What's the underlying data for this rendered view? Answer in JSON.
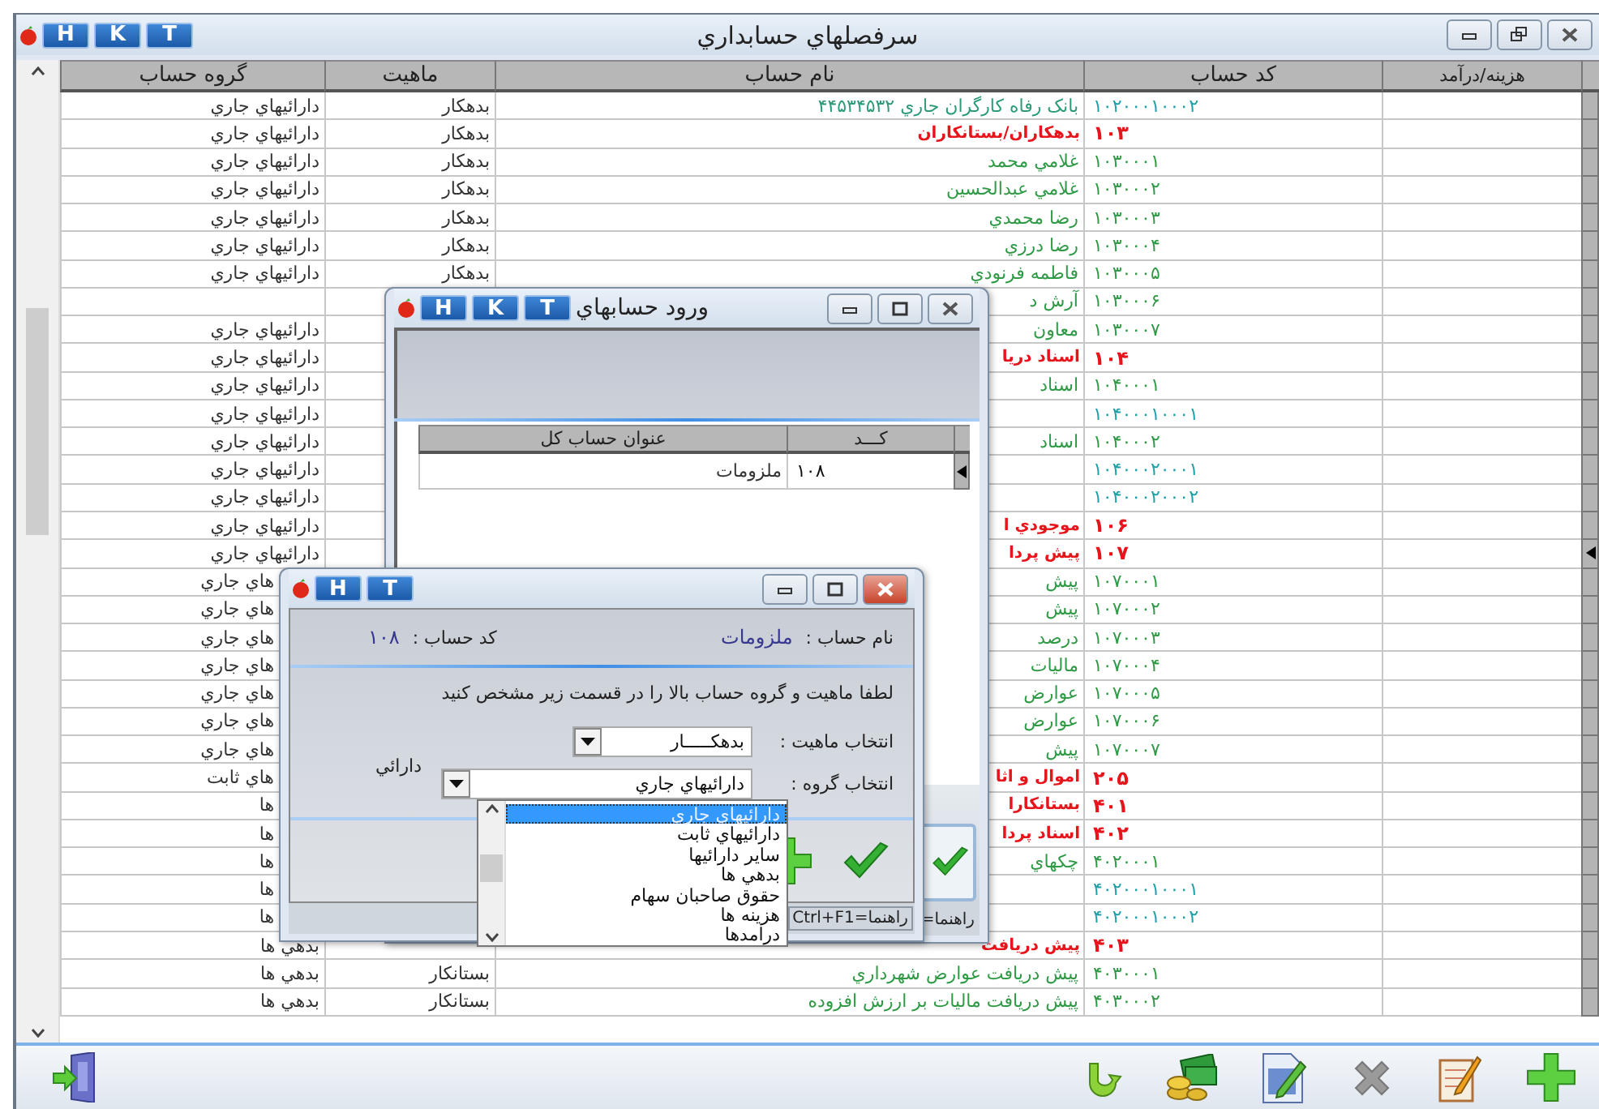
{
  "window": {
    "title": "سرفصلهاي حسابداري",
    "title_buttons": [
      "T",
      "K",
      "H"
    ]
  },
  "table": {
    "columns": [
      "هزينه/درآمد",
      "کد حساب",
      "نام حساب",
      "ماهيت",
      "گروه حساب"
    ],
    "rows": [
      {
        "kind": "sub",
        "code": "۱۰۲۰۰۰۱۰۰۰۲",
        "name": "بانک رفاه کارگران جاري ۴۴۵۳۴۵۳۲",
        "nature": "بدهکار",
        "group": "دارائيهاي جاري",
        "group_cut": false,
        "current": false
      },
      {
        "kind": "group",
        "code": "۱۰۳",
        "name": "بدهکاران/بستانکاران",
        "nature": "بدهکار",
        "group": "دارائيهاي جاري",
        "group_cut": false,
        "current": false
      },
      {
        "kind": "account",
        "code": "۱۰۳۰۰۰۱",
        "name": "غلامي محمد",
        "nature": "بدهکار",
        "group": "دارائيهاي جاري",
        "group_cut": false,
        "current": false
      },
      {
        "kind": "account",
        "code": "۱۰۳۰۰۰۲",
        "name": "غلامي عبدالحسين",
        "nature": "بدهکار",
        "group": "دارائيهاي جاري",
        "group_cut": false,
        "current": false
      },
      {
        "kind": "account",
        "code": "۱۰۳۰۰۰۳",
        "name": "رضا محمدي",
        "nature": "بدهکار",
        "group": "دارائيهاي جاري",
        "group_cut": false,
        "current": false
      },
      {
        "kind": "account",
        "code": "۱۰۳۰۰۰۴",
        "name": "رضا درزي",
        "nature": "بدهکار",
        "group": "دارائيهاي جاري",
        "group_cut": false,
        "current": false
      },
      {
        "kind": "account",
        "code": "۱۰۳۰۰۰۵",
        "name": "فاطمه فرنودي",
        "nature": "بدهکار",
        "group": "دارائيهاي جاري",
        "group_cut": false,
        "current": false
      },
      {
        "kind": "account",
        "code": "۱۰۳۰۰۰۶",
        "name": "آرش د",
        "current": false
      },
      {
        "kind": "account",
        "code": "۱۰۳۰۰۰۷",
        "name": "معاون",
        "group": "دارائيهاي جاري",
        "group_cut": false,
        "current": false
      },
      {
        "kind": "group",
        "code": "۱۰۴",
        "name": "اسناد دريا",
        "group": "دارائيهاي جاري",
        "group_cut": false,
        "current": false
      },
      {
        "kind": "account",
        "code": "۱۰۴۰۰۰۱",
        "name": "اسناد",
        "group": "دارائيهاي جاري",
        "group_cut": false,
        "current": false
      },
      {
        "kind": "sub",
        "code": "۱۰۴۰۰۰۱۰۰۰۱",
        "group": "دارائيهاي جاري",
        "group_cut": false,
        "current": false
      },
      {
        "kind": "account",
        "code": "۱۰۴۰۰۰۲",
        "name": "اسناد",
        "group": "دارائيهاي جاري",
        "group_cut": false,
        "current": false
      },
      {
        "kind": "sub",
        "code": "۱۰۴۰۰۰۲۰۰۰۱",
        "group": "دارائيهاي جاري",
        "group_cut": false,
        "current": false
      },
      {
        "kind": "sub",
        "code": "۱۰۴۰۰۰۲۰۰۰۲",
        "group": "دارائيهاي جاري",
        "group_cut": false,
        "current": false
      },
      {
        "kind": "group",
        "code": "۱۰۶",
        "name": "موجودي ا",
        "group": "دارائيهاي جاري",
        "group_cut": false,
        "current": false
      },
      {
        "kind": "group",
        "code": "۱۰۷",
        "name": "پيش پردا",
        "group": "دارائيهاي جاري",
        "group_cut": false,
        "current": true
      },
      {
        "kind": "account",
        "code": "۱۰۷۰۰۰۱",
        "name": "پيش",
        "group": "هاي جاري",
        "group_cut": true,
        "current": false
      },
      {
        "kind": "account",
        "code": "۱۰۷۰۰۰۲",
        "name": "پيش",
        "group": "هاي جاري",
        "group_cut": true,
        "current": false
      },
      {
        "kind": "account",
        "code": "۱۰۷۰۰۰۳",
        "name": "درصد",
        "group": "هاي جاري",
        "group_cut": true,
        "current": false
      },
      {
        "kind": "account",
        "code": "۱۰۷۰۰۰۴",
        "name": "ماليات",
        "group": "هاي جاري",
        "group_cut": true,
        "current": false
      },
      {
        "kind": "account",
        "code": "۱۰۷۰۰۰۵",
        "name": "عوارض",
        "group": "هاي جاري",
        "group_cut": true,
        "current": false
      },
      {
        "kind": "account",
        "code": "۱۰۷۰۰۰۶",
        "name": "عوارض",
        "group": "هاي جاري",
        "group_cut": true,
        "current": false
      },
      {
        "kind": "account",
        "code": "۱۰۷۰۰۰۷",
        "name": "پيش",
        "group": "هاي جاري",
        "group_cut": true,
        "current": false
      },
      {
        "kind": "group",
        "code": "۲۰۵",
        "name": "اموال و اثا",
        "group": "هاي ثابت",
        "group_cut": true,
        "current": false
      },
      {
        "kind": "group",
        "code": "۴۰۱",
        "name": "بستانکارا",
        "group": "ها",
        "group_cut": true,
        "current": false
      },
      {
        "kind": "group",
        "code": "۴۰۲",
        "name": "اسناد پردا",
        "group": "ها",
        "group_cut": true,
        "current": false
      },
      {
        "kind": "account",
        "code": "۴۰۲۰۰۰۱",
        "name": "چکهاي",
        "group": "ها",
        "group_cut": true,
        "current": false
      },
      {
        "kind": "sub",
        "code": "۴۰۲۰۰۰۱۰۰۰۱",
        "group": "ها",
        "group_cut": true,
        "current": false
      },
      {
        "kind": "sub",
        "code": "۴۰۲۰۰۰۱۰۰۰۲",
        "group": "ها",
        "group_cut": true,
        "current": false
      },
      {
        "kind": "group",
        "code": "۴۰۳",
        "name": "پيش دريافت",
        "group": "بدهي ها",
        "group_cut": false,
        "current": false
      },
      {
        "kind": "account",
        "code": "۴۰۳۰۰۰۱",
        "name": "پيش دريافت عوارض شهرداري",
        "nature": "بستانکار",
        "group": "بدهي ها",
        "group_cut": false,
        "current": false
      },
      {
        "kind": "account",
        "code": "۴۰۳۰۰۰۲",
        "name": "پيش دريافت ماليات بر ارزش افزوده",
        "nature": "بستانکار",
        "group": "بدهي ها",
        "group_cut": false,
        "current": false
      }
    ]
  },
  "entry_window": {
    "title": "ورود حسابهاي",
    "title_buttons": [
      "T",
      "K",
      "H"
    ],
    "table": {
      "columns": [
        "کـــد",
        "عنوان حساب کل"
      ],
      "rows": [
        {
          "title": "ملزومات",
          "code": "۱۰۸",
          "current": true
        }
      ]
    },
    "status": "راهنما="
  },
  "group_dialog": {
    "title_buttons": [
      "T",
      "H"
    ],
    "account_name_label": "نام حساب :",
    "account_name": "ملزومات",
    "code_label": "کد حساب :",
    "code": "۱۰۸",
    "instruction": "لطفا ماهيت و گروه حساب بالا را در قسمت زير مشخص کنيد",
    "nature_label": "انتخاب ماهيت :",
    "nature_value": "بدهکـــــار",
    "group_label": "انتخاب گروه :",
    "group_value": "دارائيهاي جاري",
    "group_hint": "دارائي",
    "group_options": [
      {
        "label": "دارائيهاي جاري",
        "selected": true
      },
      {
        "label": "دارائيهاي ثابت",
        "selected": false
      },
      {
        "label": "ساير دارائيها",
        "selected": false
      },
      {
        "label": "بدهي ها",
        "selected": false
      },
      {
        "label": "حقوق صاحبان سهام",
        "selected": false
      },
      {
        "label": "هزينه ها",
        "selected": false
      },
      {
        "label": "درامدها",
        "selected": false
      }
    ],
    "status": "راهنما=Ctrl+F1"
  }
}
